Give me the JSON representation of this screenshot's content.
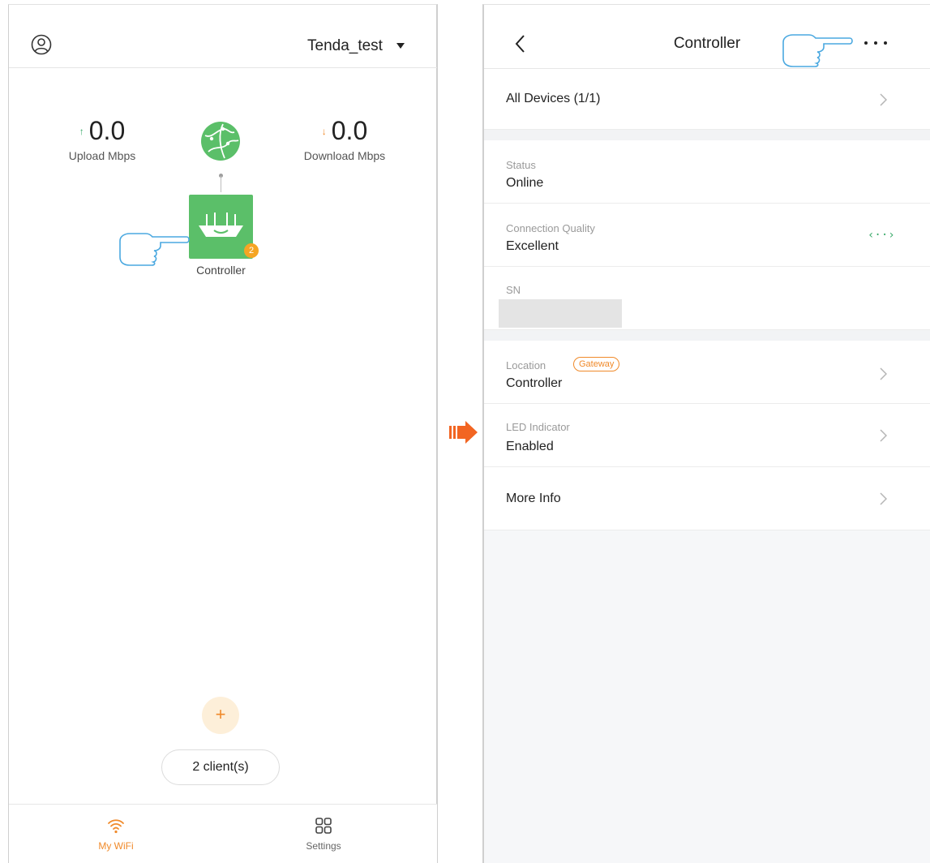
{
  "left_screen": {
    "header": {
      "network_name": "Tenda_test",
      "account_icon": "account-circle-icon",
      "dropdown_icon": "caret-down-icon"
    },
    "stats": {
      "upload": {
        "arrow": "↑",
        "value": "0.0",
        "label": "Upload Mbps"
      },
      "download": {
        "arrow": "↓",
        "value": "0.0",
        "label": "Download Mbps"
      }
    },
    "topology": {
      "internet_icon": "globe-icon",
      "router_icon": "router-icon",
      "router_label": "Controller",
      "badge_count": "2"
    },
    "add_button": "+",
    "clients_button": "2 client(s)",
    "tabs": [
      {
        "label": "My WiFi",
        "icon": "wifi-icon",
        "active": true
      },
      {
        "label": "Settings",
        "icon": "grid-icon",
        "active": false
      }
    ]
  },
  "right_screen": {
    "header": {
      "title": "Controller",
      "back_icon": "chevron-left-icon",
      "more_icon": "more-dots-icon"
    },
    "all_devices": "All Devices (1/1)",
    "status": {
      "label": "Status",
      "value": "Online"
    },
    "connection_quality": {
      "label": "Connection Quality",
      "value": "Excellent",
      "icon": "‹··›"
    },
    "sn": {
      "label": "SN"
    },
    "location": {
      "label": "Location",
      "badge": "Gateway",
      "value": "Controller"
    },
    "led_indicator": {
      "label": "LED Indicator",
      "value": "Enabled"
    },
    "more_info": "More Info"
  },
  "colors": {
    "accent_orange": "#f08a2a",
    "accent_green": "#5bbf69",
    "upload_green": "#3aaa6a",
    "pointer_blue": "#4aa8e0"
  }
}
